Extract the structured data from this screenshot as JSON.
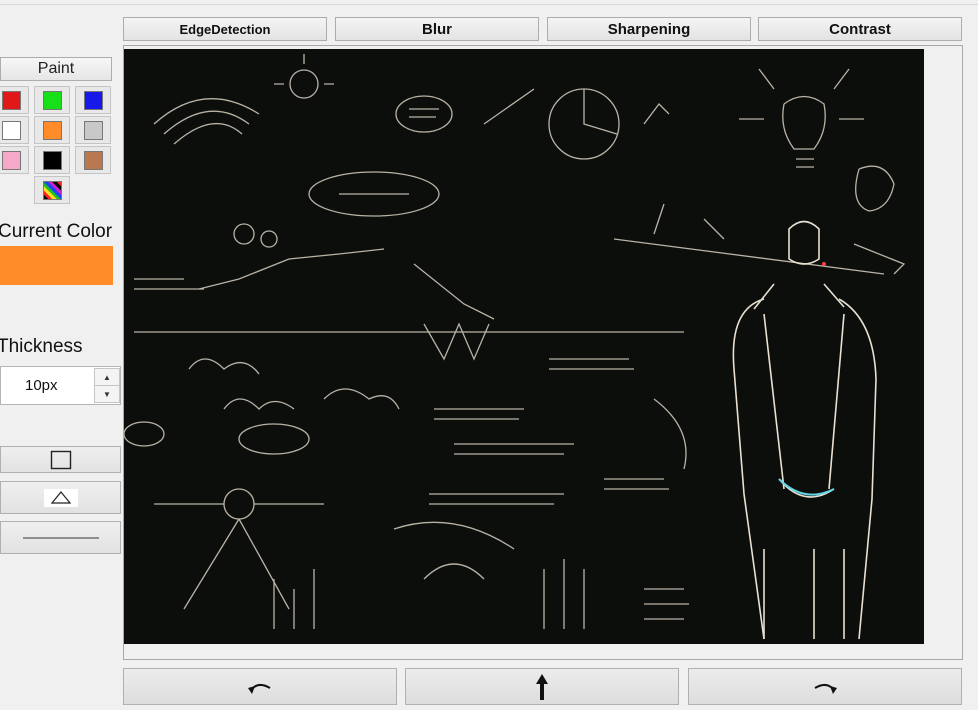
{
  "toolbar": {
    "edge_detection": "EdgeDetection",
    "blur": "Blur",
    "sharpening": "Sharpening",
    "contrast": "Contrast"
  },
  "left_panel": {
    "paint_label": "Paint",
    "swatches": [
      {
        "name": "red",
        "color": "#e01818"
      },
      {
        "name": "green",
        "color": "#18e018"
      },
      {
        "name": "blue",
        "color": "#1818e8"
      },
      {
        "name": "white",
        "color": "#ffffff"
      },
      {
        "name": "orange",
        "color": "#ff8c28"
      },
      {
        "name": "light-gray",
        "color": "#c8c8c8"
      },
      {
        "name": "pink",
        "color": "#f7a8c8"
      },
      {
        "name": "black",
        "color": "#000000"
      },
      {
        "name": "brown",
        "color": "#b87850"
      },
      {
        "name": "multicolor",
        "color": "multi"
      }
    ],
    "current_color_label": "Current Color",
    "current_color": "#ff8c28",
    "thickness_label": "Thickness",
    "thickness_value": "10px",
    "tools": [
      "rectangle-icon",
      "triangle-icon",
      "line-icon"
    ]
  },
  "canvas": {
    "description_icon": "edge-detected-image"
  },
  "bottom_bar": {
    "icons": [
      "undo-icon",
      "upload-icon",
      "redo-icon"
    ]
  }
}
